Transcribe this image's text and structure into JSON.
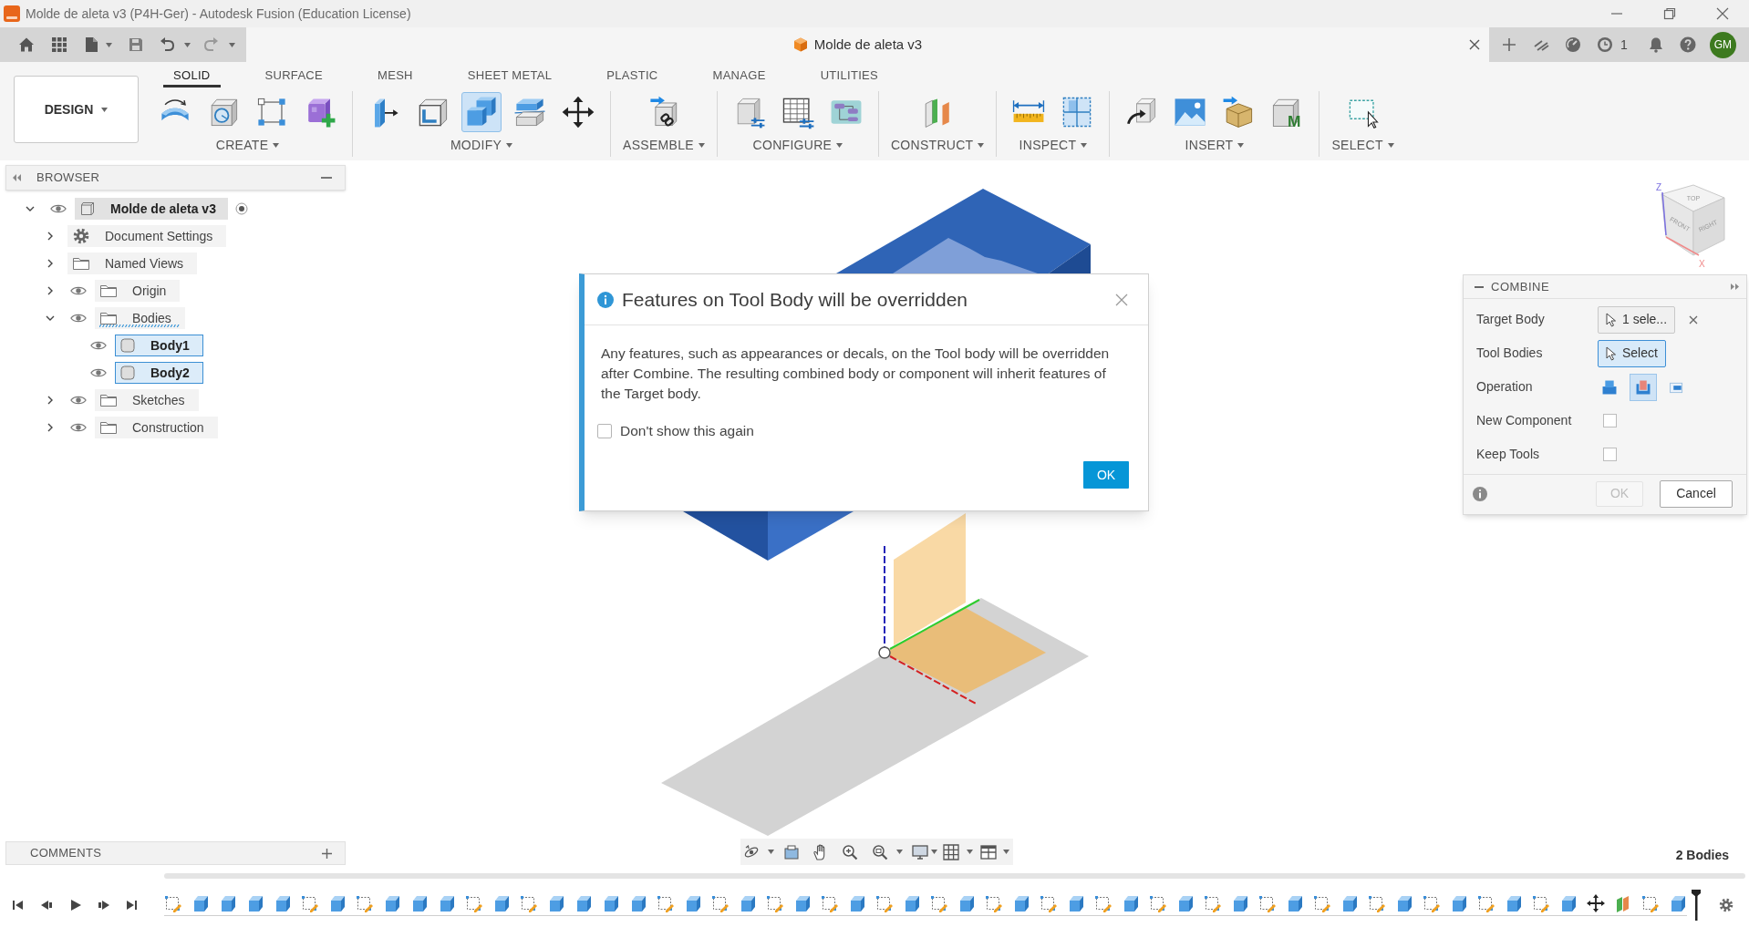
{
  "window": {
    "title": "Molde de aleta v3 (P4H-Ger) - Autodesk Fusion (Education License)"
  },
  "document_tab": {
    "title": "Molde de aleta v3"
  },
  "header_right": {
    "job_count": "1",
    "avatar": "GM"
  },
  "workspace": {
    "label": "DESIGN"
  },
  "toolbar_tabs": [
    {
      "label": "SOLID",
      "selected": true
    },
    {
      "label": "SURFACE",
      "selected": false
    },
    {
      "label": "MESH",
      "selected": false
    },
    {
      "label": "SHEET METAL",
      "selected": false
    },
    {
      "label": "PLASTIC",
      "selected": false
    },
    {
      "label": "MANAGE",
      "selected": false
    },
    {
      "label": "UTILITIES",
      "selected": false
    }
  ],
  "toolbar_groups": [
    {
      "label": "CREATE",
      "tools": [
        {
          "kind": "revolve",
          "selected": false
        },
        {
          "kind": "hole",
          "selected": false
        },
        {
          "kind": "pattern",
          "selected": false
        },
        {
          "kind": "component",
          "selected": false
        }
      ]
    },
    {
      "label": "MODIFY",
      "tools": [
        {
          "kind": "press_pull",
          "selected": false
        },
        {
          "kind": "shell",
          "selected": false
        },
        {
          "kind": "combine",
          "selected": true
        },
        {
          "kind": "split",
          "selected": false
        },
        {
          "kind": "move",
          "selected": false
        }
      ]
    },
    {
      "label": "ASSEMBLE",
      "tools": [
        {
          "kind": "joint",
          "selected": false
        }
      ]
    },
    {
      "label": "CONFIGURE",
      "tools": [
        {
          "kind": "parameters",
          "selected": false
        },
        {
          "kind": "table",
          "selected": false
        },
        {
          "kind": "rules",
          "selected": false
        }
      ]
    },
    {
      "label": "CONSTRUCT",
      "tools": [
        {
          "kind": "planes",
          "selected": false
        }
      ]
    },
    {
      "label": "INSPECT",
      "tools": [
        {
          "kind": "measure",
          "selected": false
        },
        {
          "kind": "section",
          "selected": false
        }
      ]
    },
    {
      "label": "INSERT",
      "tools": [
        {
          "kind": "derive",
          "selected": false
        },
        {
          "kind": "canvas",
          "selected": false
        },
        {
          "kind": "supplier_part",
          "selected": false
        },
        {
          "kind": "material",
          "letter": "M",
          "selected": false
        }
      ]
    },
    {
      "label": "SELECT",
      "tools": [
        {
          "kind": "select",
          "selected": false
        }
      ]
    }
  ],
  "browser": {
    "title": "BROWSER",
    "tree": [
      {
        "label": "Molde de aleta v3",
        "kind": "component",
        "expanded": true,
        "visible": true,
        "selected": false,
        "active": true,
        "children": [
          {
            "label": "Document Settings",
            "kind": "settings",
            "expanded": false,
            "selected": false,
            "drop_target": false
          },
          {
            "label": "Named Views",
            "kind": "folder",
            "expanded": false,
            "selected": false,
            "drop_target": false
          },
          {
            "label": "Origin",
            "kind": "folder",
            "expanded": false,
            "visible": true,
            "selected": false,
            "drop_target": false
          },
          {
            "label": "Bodies",
            "kind": "folder",
            "expanded": true,
            "visible": true,
            "selected": false,
            "drop_target": true,
            "children": [
              {
                "label": "Body1",
                "kind": "body",
                "visible": true,
                "selected": true
              },
              {
                "label": "Body2",
                "kind": "body",
                "visible": true,
                "selected": true
              }
            ]
          },
          {
            "label": "Sketches",
            "kind": "folder",
            "expanded": false,
            "visible": true,
            "selected": false,
            "drop_target": false
          },
          {
            "label": "Construction",
            "kind": "folder",
            "expanded": false,
            "visible": true,
            "selected": false,
            "drop_target": false
          }
        ]
      }
    ]
  },
  "view_cube": {
    "faces": [
      "TOP",
      "FRONT",
      "RIGHT"
    ],
    "axes": [
      "Z",
      "X"
    ]
  },
  "dialog": {
    "title": "Features on Tool Body will be overridden",
    "message": "Any features, such as appearances or decals, on the Tool body will be overridden after Combine. The resulting combined body or component will inherit features of the Target body.",
    "checkbox": {
      "label": "Don't show this again",
      "checked": false
    },
    "ok_button": "OK"
  },
  "combine_panel": {
    "title": "COMBINE",
    "rows": [
      {
        "kind": "selection",
        "label": "Target Body",
        "value": "1 sele...",
        "active": false,
        "clearable": true
      },
      {
        "kind": "selection",
        "label": "Tool Bodies",
        "value": "Select",
        "active": true
      },
      {
        "kind": "operation",
        "label": "Operation",
        "options": [
          {
            "kind": "join",
            "selected": false
          },
          {
            "kind": "cut",
            "selected": true
          },
          {
            "kind": "intersect",
            "selected": false
          }
        ]
      },
      {
        "kind": "checkbox",
        "label": "New Component",
        "checked": false
      },
      {
        "kind": "checkbox",
        "label": "Keep Tools",
        "checked": false
      }
    ],
    "ok_button": {
      "label": "OK",
      "disabled": true
    },
    "cancel_button": "Cancel"
  },
  "comments": {
    "title": "COMMENTS"
  },
  "status": {
    "text": "2 Bodies"
  },
  "timeline": {
    "features": [
      {
        "kind": "sketch"
      },
      {
        "kind": "extrude"
      },
      {
        "kind": "extrude"
      },
      {
        "kind": "extrude"
      },
      {
        "kind": "extrude"
      },
      {
        "kind": "sketch"
      },
      {
        "kind": "extrude"
      },
      {
        "kind": "sketch"
      },
      {
        "kind": "extrude"
      },
      {
        "kind": "extrude"
      },
      {
        "kind": "extrude"
      },
      {
        "kind": "sketch"
      },
      {
        "kind": "extrude"
      },
      {
        "kind": "sketch"
      },
      {
        "kind": "extrude"
      },
      {
        "kind": "extrude"
      },
      {
        "kind": "extrude"
      },
      {
        "kind": "extrude"
      },
      {
        "kind": "sketch"
      },
      {
        "kind": "extrude"
      },
      {
        "kind": "sketch"
      },
      {
        "kind": "extrude"
      },
      {
        "kind": "sketch"
      },
      {
        "kind": "extrude"
      },
      {
        "kind": "sketch"
      },
      {
        "kind": "extrude"
      },
      {
        "kind": "sketch"
      },
      {
        "kind": "extrude"
      },
      {
        "kind": "sketch"
      },
      {
        "kind": "extrude"
      },
      {
        "kind": "sketch"
      },
      {
        "kind": "extrude"
      },
      {
        "kind": "sketch"
      },
      {
        "kind": "extrude"
      },
      {
        "kind": "sketch"
      },
      {
        "kind": "extrude"
      },
      {
        "kind": "sketch"
      },
      {
        "kind": "extrude"
      },
      {
        "kind": "sketch"
      },
      {
        "kind": "extrude"
      },
      {
        "kind": "sketch"
      },
      {
        "kind": "extrude"
      },
      {
        "kind": "sketch"
      },
      {
        "kind": "extrude"
      },
      {
        "kind": "sketch"
      },
      {
        "kind": "extrude"
      },
      {
        "kind": "sketch"
      },
      {
        "kind": "extrude"
      },
      {
        "kind": "sketch"
      },
      {
        "kind": "extrude"
      },
      {
        "kind": "sketch"
      },
      {
        "kind": "extrude"
      },
      {
        "kind": "move"
      },
      {
        "kind": "plane"
      },
      {
        "kind": "sketch"
      },
      {
        "kind": "extrude"
      }
    ]
  }
}
